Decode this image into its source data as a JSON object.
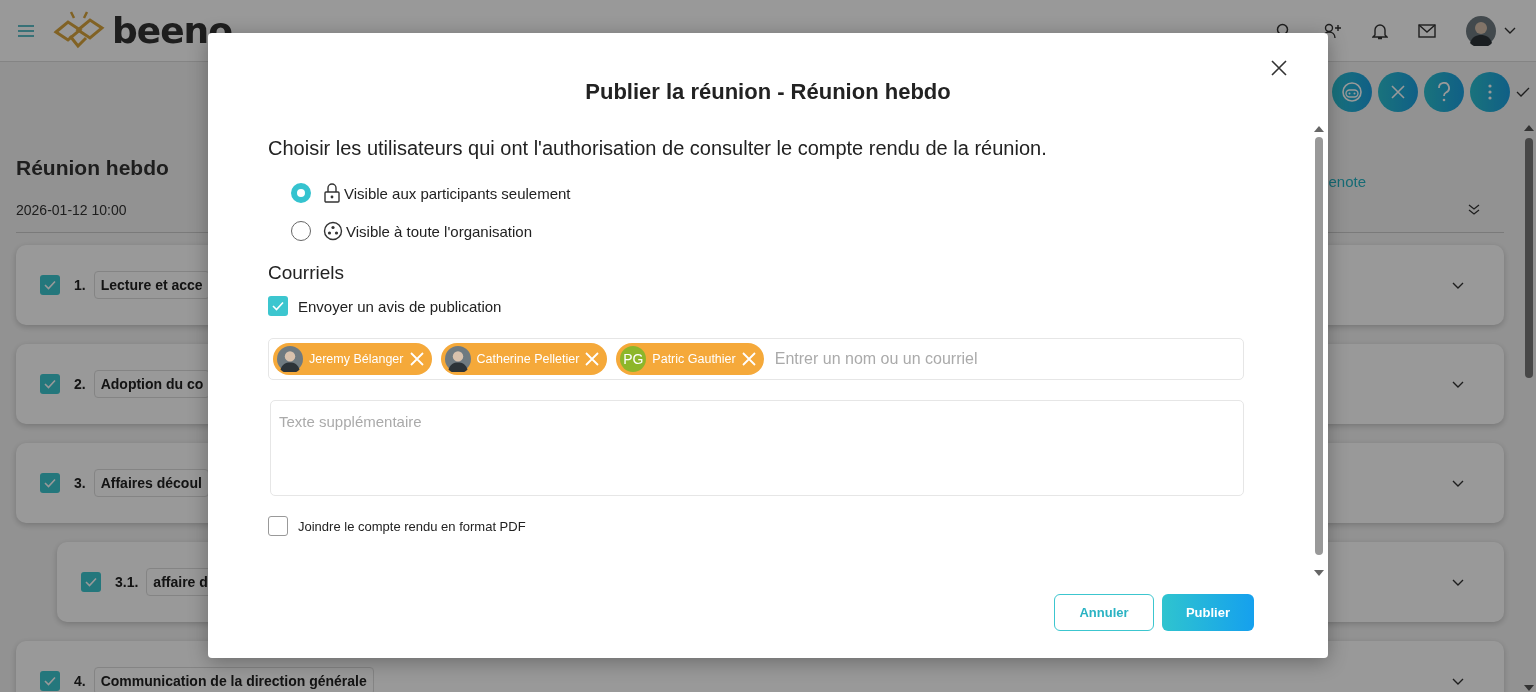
{
  "header": {
    "logo": "beeno"
  },
  "meeting": {
    "title": "Réunion hebdo",
    "date": "2026-01-12 10:00",
    "link": "enote",
    "agenda": [
      {
        "number": "1.",
        "title": "Lecture et acce",
        "checked": true
      },
      {
        "number": "2.",
        "title": "Adoption du co",
        "checked": true
      },
      {
        "number": "3.",
        "title": "Affaires découl",
        "checked": true,
        "children": [
          {
            "number": "3.1.",
            "title": "affaire d",
            "checked": true
          }
        ]
      },
      {
        "number": "4.",
        "title": "Communication de la direction générale",
        "checked": true
      }
    ]
  },
  "dialog": {
    "title": "Publier la réunion - Réunion hebdo",
    "prompt": "Choisir les utilisateurs qui ont l'authorisation de consulter le compte rendu de la réunion.",
    "visibility": [
      {
        "label": "Visible aux participants seulement",
        "kind": "lock",
        "selected": true
      },
      {
        "label": "Visible à toute l'organisation",
        "kind": "group",
        "selected": false
      }
    ],
    "emails_heading": "Courriels",
    "notify": {
      "label": "Envoyer un avis de publication",
      "checked": true
    },
    "recipients": [
      {
        "name": "Jeremy Bélanger",
        "kind": "photo"
      },
      {
        "name": "Catherine Pelletier",
        "kind": "photo"
      },
      {
        "name": "Patric Gauthier",
        "kind": "initials",
        "initials": "PG"
      }
    ],
    "recipient_placeholder": "Entrer un nom ou un courriel",
    "message_placeholder": "Texte supplémentaire",
    "attach_pdf": {
      "label": "Joindre le compte rendu en format PDF",
      "checked": false
    },
    "buttons": [
      {
        "label": "Annuler",
        "kind": "secondary"
      },
      {
        "label": "Publier",
        "kind": "primary"
      }
    ]
  }
}
